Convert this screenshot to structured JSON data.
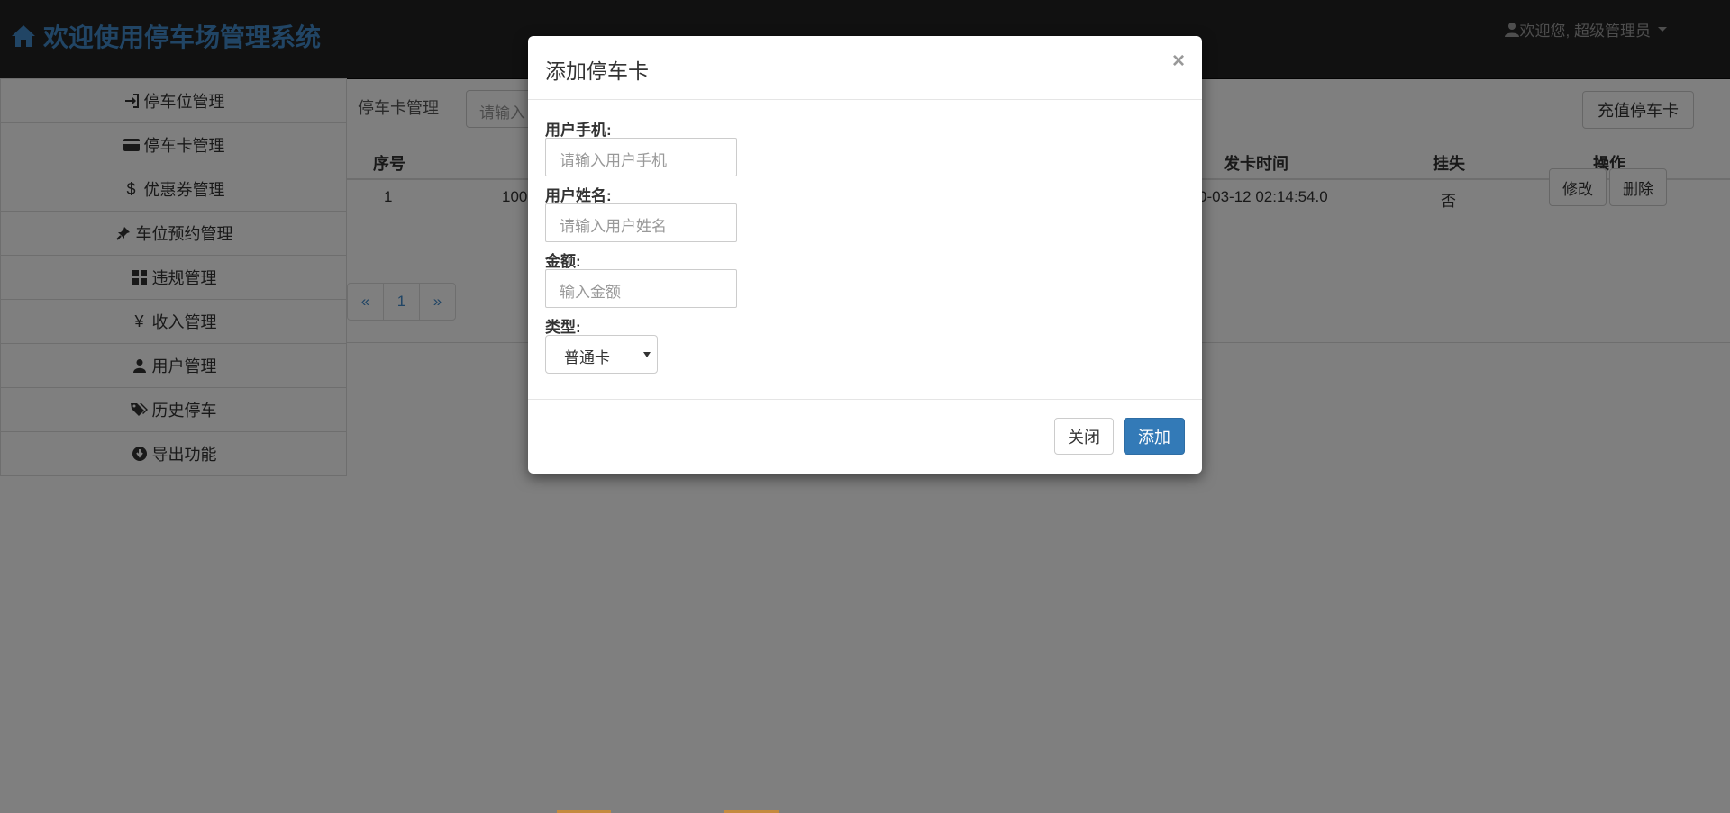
{
  "header": {
    "brand": "欢迎使用停车场管理系统",
    "user_greeting": "欢迎您, 超级管理员"
  },
  "sidebar": {
    "items": [
      {
        "label": "停车位管理",
        "icon": "log-in-icon"
      },
      {
        "label": "停车卡管理",
        "icon": "credit-card-icon"
      },
      {
        "label": "优惠券管理",
        "icon": "dollar-icon"
      },
      {
        "label": "车位预约管理",
        "icon": "pushpin-icon"
      },
      {
        "label": "违规管理",
        "icon": "th-large-icon"
      },
      {
        "label": "收入管理",
        "icon": "yen-icon"
      },
      {
        "label": "用户管理",
        "icon": "user-icon"
      },
      {
        "label": "历史停车",
        "icon": "tags-icon"
      },
      {
        "label": "导出功能",
        "icon": "download-icon"
      }
    ]
  },
  "main": {
    "section_label": "停车卡管理",
    "search_placeholder": "请输入",
    "recharge_label": "充值停车卡",
    "table": {
      "headers": [
        "序号",
        "发卡时间",
        "挂失",
        "操作"
      ],
      "rows": [
        {
          "index": "1",
          "card_no_partial": "100",
          "issue_time": "0-03-12 02:14:54.0",
          "lost": "否"
        }
      ]
    },
    "row_edit": "修改",
    "row_delete": "删除",
    "pager": {
      "prev": "«",
      "page": "1",
      "next": "»"
    }
  },
  "modal": {
    "title": "添加停车卡",
    "close_glyph": "×",
    "fields": {
      "phone_label": "用户手机:",
      "phone_placeholder": "请输入用户手机",
      "name_label": "用户姓名:",
      "name_placeholder": "请输入用户姓名",
      "amount_label": "金额:",
      "amount_placeholder": "输入金额",
      "type_label": "类型:",
      "type_value": "普通卡"
    },
    "close_label": "关闭",
    "add_label": "添加"
  },
  "colors": {
    "brand": "#428bca",
    "primary": "#337ab7",
    "navbar": "#222222"
  }
}
